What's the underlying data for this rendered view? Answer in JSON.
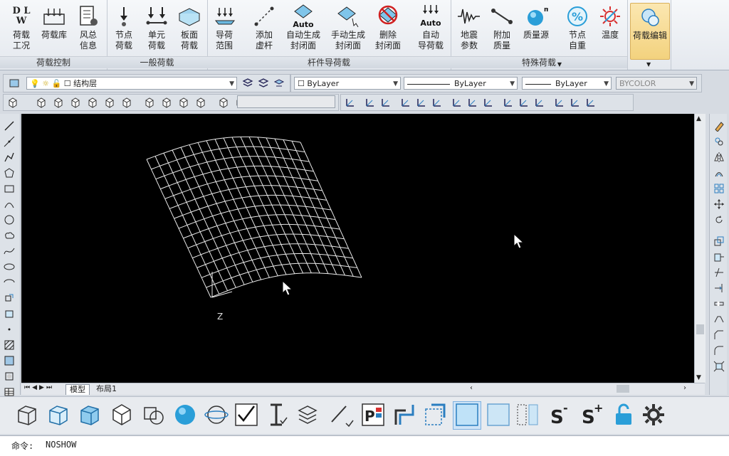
{
  "ribbon": {
    "groups": [
      {
        "label": "荷载控制",
        "buttons": [
          {
            "label": "荷载\n工况",
            "icon": "dlw-icon"
          },
          {
            "label": "荷载库",
            "icon": "load-library-icon"
          },
          {
            "label": "风总\n信息",
            "icon": "wind-info-icon"
          }
        ]
      },
      {
        "label": "一般荷载",
        "buttons": [
          {
            "label": "节点\n荷载",
            "icon": "node-load-icon"
          },
          {
            "label": "单元\n荷载",
            "icon": "element-load-icon"
          },
          {
            "label": "板面\n荷载",
            "icon": "plate-load-icon"
          }
        ]
      },
      {
        "label": "杆件导荷载",
        "buttons": [
          {
            "label": "导荷\n范围",
            "icon": "load-range-icon"
          },
          {
            "label": "添加\n虚杆",
            "icon": "virtual-bar-icon"
          },
          {
            "label": "自动生成\n封闭面",
            "icon": "auto-closed-face-icon"
          },
          {
            "label": "手动生成\n封闭面",
            "icon": "manual-closed-face-icon"
          },
          {
            "label": "删除\n封闭面",
            "icon": "delete-closed-face-icon"
          },
          {
            "label": "自动\n导荷载",
            "icon": "auto-load-guide-icon"
          }
        ]
      },
      {
        "label": "特殊荷载",
        "buttons": [
          {
            "label": "地震\n参数",
            "icon": "seismic-icon"
          },
          {
            "label": "附加\n质量",
            "icon": "added-mass-icon"
          },
          {
            "label": "质量源",
            "icon": "mass-source-icon"
          },
          {
            "label": "节点\n自重",
            "icon": "node-selfweight-icon"
          },
          {
            "label": "温度",
            "icon": "temperature-icon"
          }
        ]
      },
      {
        "label": "",
        "buttons": [
          {
            "label": "荷载编辑",
            "icon": "load-edit-icon"
          }
        ]
      }
    ],
    "auto_text": "Auto",
    "dlw_text": "D L\nW"
  },
  "layer_toolbar": {
    "layer_name": "结构层",
    "color": "ByLayer",
    "linetype": "ByLayer",
    "lineweight": "ByLayer",
    "plotstyle": "BYCOLOR"
  },
  "tabs": [
    "模型",
    "布局1"
  ],
  "cmdline": {
    "prompt": "命令:",
    "text": "NOSHOW"
  },
  "axis_label": "Z",
  "colors": {
    "viewport": "#000000",
    "mesh": "#e8e8e8",
    "ribbon_active": "#f3d27e"
  }
}
